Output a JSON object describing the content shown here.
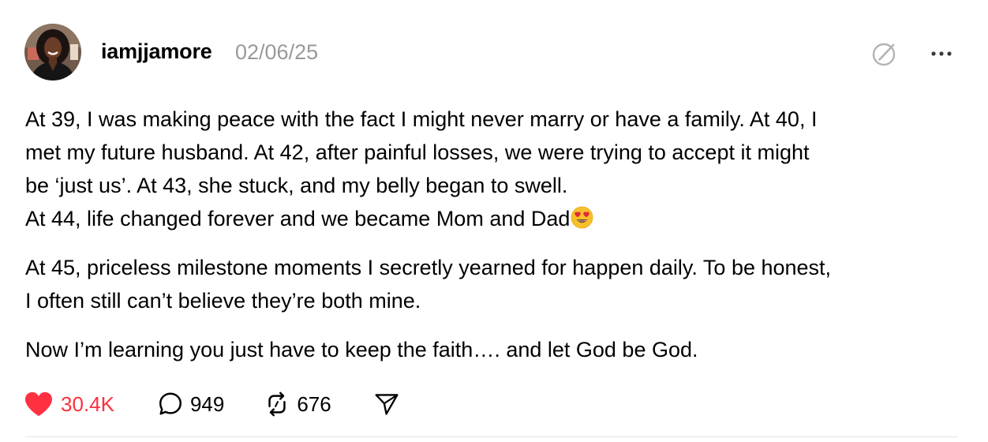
{
  "post": {
    "username": "iamjjamore",
    "timestamp": "02/06/25",
    "paragraphs": [
      [
        "At 39, I was making peace with the fact I might never marry or have a family. At 40, I",
        "met my future husband. At 42, after painful losses, we were trying to accept it might",
        "be ‘just us’. At 43, she stuck, and my belly began to swell.",
        "At 44, life changed forever and we became Mom and Dad"
      ],
      [
        "At 45, priceless milestone moments I secretly yearned for happen daily. To be honest,",
        "I often still can’t believe they’re both mine."
      ],
      [
        "Now I’m learning you just have to keep the faith…. and let God be God."
      ]
    ],
    "emoji": "heart-eyes-emoji",
    "stats": {
      "likes": "30.4K",
      "replies": "949",
      "reposts": "676"
    }
  },
  "icons": {
    "like": "heart-icon",
    "reply": "comment-bubble-icon",
    "repost": "repost-icon",
    "share": "share-paper-plane-icon",
    "edit": "edit-icon",
    "more": "more-options-icon"
  },
  "colors": {
    "like": "#ff3040",
    "timestamp": "#999999",
    "text": "#000000",
    "icon_muted": "#b3b3b3",
    "divider": "#e3e3e3"
  }
}
